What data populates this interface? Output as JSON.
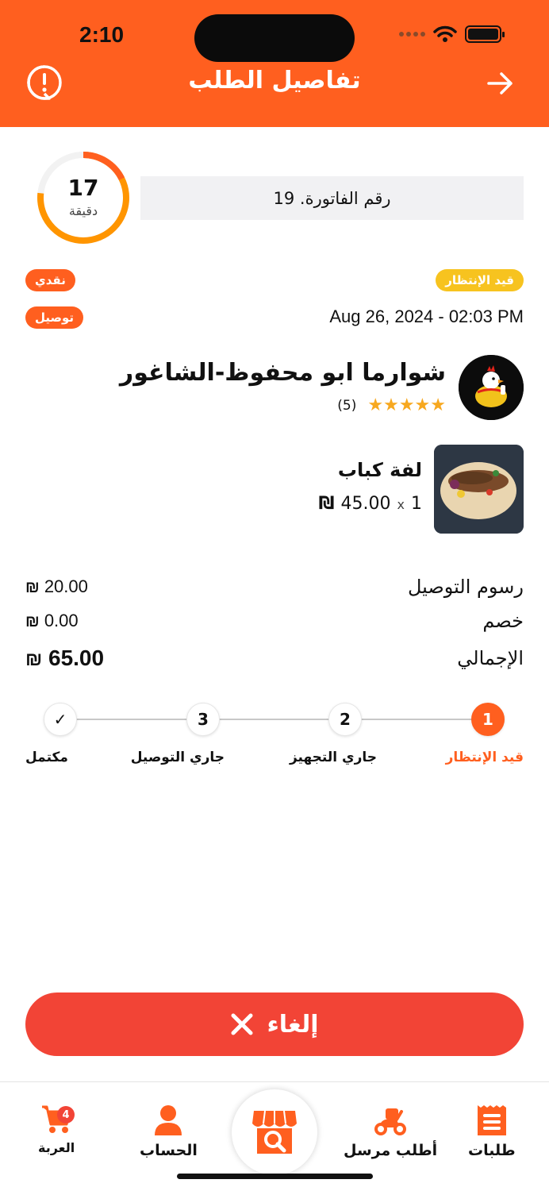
{
  "status_bar": {
    "time": "2:10"
  },
  "header": {
    "title": "تفاصيل الطلب",
    "help_icon": "alert-circle-icon",
    "back_icon": "arrow-right-icon",
    "color": "#ff5f1f"
  },
  "timer": {
    "value": "17",
    "unit": "دقيقة"
  },
  "invoice": {
    "text": "رقم الفاتورة. 19"
  },
  "badges": {
    "status": "قيد الإنتظار",
    "payment": "نقدي",
    "type": "توصيل"
  },
  "order_datetime": "Aug 26, 2024 - 02:03 PM",
  "restaurant": {
    "name": "شوارما ابو محفوظ-الشاغور",
    "stars": "★★★★★",
    "rating_count": "(5)"
  },
  "item": {
    "name": "لفة كباب",
    "quantity": "1",
    "times": "x",
    "price": "45.00",
    "currency": "₪"
  },
  "summary": [
    {
      "label": "رسوم التوصيل",
      "value": "20.00",
      "currency": "₪"
    },
    {
      "label": "خصم",
      "value": "0.00",
      "currency": "₪"
    },
    {
      "label": "الإجمالي",
      "value": "65.00",
      "currency": "₪"
    }
  ],
  "steps": [
    {
      "number": "1",
      "label": "قيد الإنتظار",
      "active": true
    },
    {
      "number": "2",
      "label": "جاري التجهيز"
    },
    {
      "number": "3",
      "label": "جاري التوصيل"
    },
    {
      "number": "✓",
      "label": "مكتمل"
    }
  ],
  "cancel_button": {
    "label": "إلغاء",
    "icon": "close-icon",
    "color": "#f24436"
  },
  "tabbar": {
    "orders": "طلبات",
    "courier": "أطلب مرسل",
    "account": "الحساب",
    "cart": "العربة",
    "cart_count": "4",
    "center_icon": "store-search-icon"
  }
}
